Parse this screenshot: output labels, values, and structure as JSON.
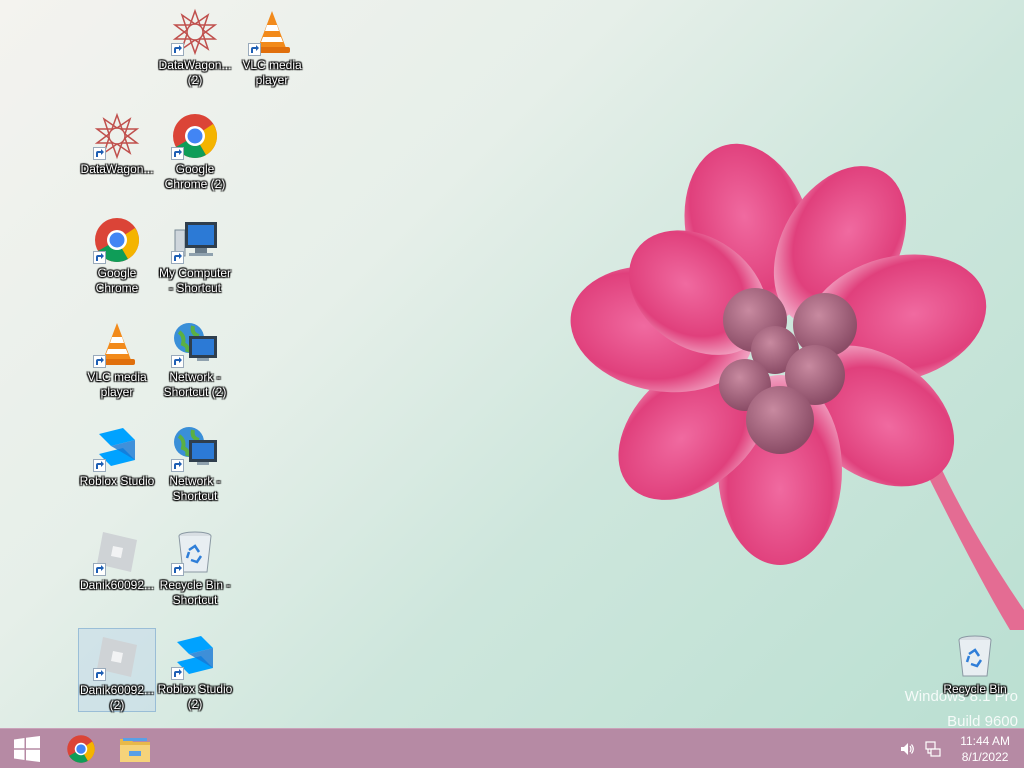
{
  "desktop": {
    "icons": [
      {
        "label": "DataWagon... (2)",
        "icon": "datawagon-icon"
      },
      {
        "label": "VLC media player",
        "icon": "vlc-icon"
      },
      {
        "label": "DataWagon...",
        "icon": "datawagon-icon"
      },
      {
        "label": "Google Chrome (2)",
        "icon": "chrome-icon"
      },
      {
        "label": "Google Chrome",
        "icon": "chrome-icon"
      },
      {
        "label": "My Computer - Shortcut",
        "icon": "computer-icon"
      },
      {
        "label": "VLC media player",
        "icon": "vlc-icon"
      },
      {
        "label": "Network - Shortcut (2)",
        "icon": "network-icon"
      },
      {
        "label": "Roblox Studio",
        "icon": "roblox-studio-icon"
      },
      {
        "label": "Network - Shortcut",
        "icon": "network-icon"
      },
      {
        "label": "Danik60092...",
        "icon": "roblox-icon"
      },
      {
        "label": "Recycle Bin - Shortcut",
        "icon": "recycle-bin-icon"
      },
      {
        "label": "Danik60092... (2)",
        "icon": "roblox-icon"
      },
      {
        "label": "Roblox Studio (2)",
        "icon": "roblox-studio-icon"
      },
      {
        "label": "Recycle Bin",
        "icon": "recycle-bin-icon"
      }
    ]
  },
  "watermark": {
    "line1": "Windows 8.1 Pro",
    "line2": "Build 9600"
  },
  "taskbar": {
    "start_icon": "windows-logo-icon",
    "pinned": [
      {
        "name": "Google Chrome",
        "icon": "chrome-icon"
      },
      {
        "name": "File Explorer",
        "icon": "folder-icon"
      }
    ],
    "tray": {
      "volume_icon": "speaker-icon",
      "network_icon": "network-tray-icon",
      "time": "11:44 AM",
      "date": "8/1/2022"
    }
  },
  "colors": {
    "taskbar": "#b68aa4",
    "flower": "#e0457f",
    "background": "#cde6dc"
  }
}
